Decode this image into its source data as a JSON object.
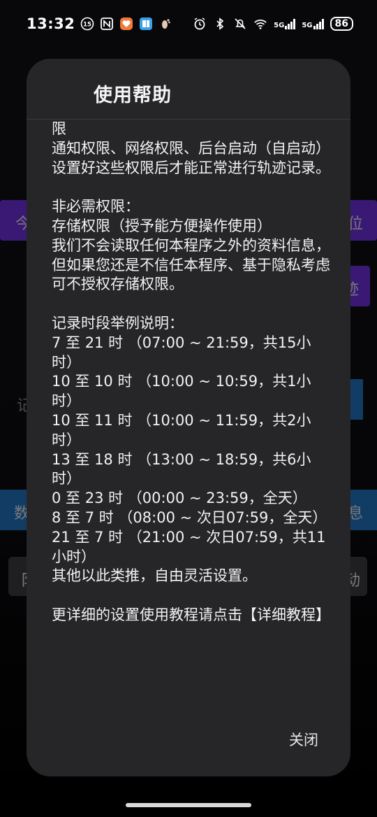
{
  "status_bar": {
    "time": "13:32",
    "notif_badge": "15",
    "net1": "5G",
    "net2": "5G",
    "battery": "86"
  },
  "background": {
    "left_purple_text": "今",
    "right_purple_text": "位",
    "right_purple2_text": "迹",
    "mid_left_text": "记",
    "left_blue_text": "数",
    "right_blue_text": "息",
    "left_grey_text": "阝",
    "right_grey_text": "动"
  },
  "dialog": {
    "title": "使用帮助",
    "lines": [
      "限",
      "通知权限、网络权限、后台启动（自启动）",
      "设置好这些权限后才能正常进行轨迹记录。",
      "",
      "非必需权限：",
      "存储权限（授予能方便操作使用）",
      "我们不会读取任何本程序之外的资料信息，但如果您还是不信任本程序、基于隐私考虑可不授权存储权限。",
      "",
      "记录时段举例说明：",
      "7 至 21 时 （07:00 ~ 21:59，共15小时）",
      "10 至 10 时 （10:00 ~ 10:59，共1小时）",
      "10 至 11 时 （10:00 ~ 11:59，共2小时）",
      "13 至 18 时 （13:00 ~ 18:59，共6小时）",
      "0 至 23 时 （00:00 ~ 23:59，全天）",
      "8 至 7 时 （08:00 ~ 次日07:59，全天）",
      "21 至 7 时 （21:00 ~ 次日07:59，共11小时）",
      "其他以此类推，自由灵活设置。",
      "",
      "更详细的设置使用教程请点击【详细教程】"
    ],
    "close_label": "关闭"
  }
}
